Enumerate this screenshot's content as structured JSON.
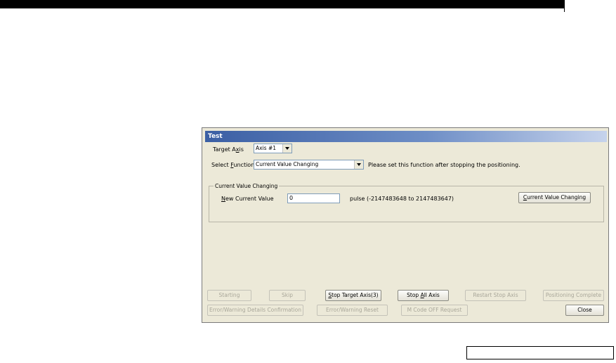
{
  "dialog": {
    "title": "Test",
    "target_axis": {
      "label_pre": "Target A",
      "label_key": "x",
      "label_post": "is",
      "value": "Axis #1"
    },
    "select_function": {
      "label_pre": "Select ",
      "label_key": "F",
      "label_post": "unction",
      "value": "Current Value Changing"
    },
    "note": "Please set this function after stopping the positioning.",
    "group": {
      "legend": "Current Value Changing",
      "field_label_key": "N",
      "field_label_post": "ew Current Value",
      "field_value": "0",
      "range_text": "pulse (-2147483648 to 2147483647)",
      "action_key": "C",
      "action_post": "urrent Value Changing"
    },
    "buttons_row1": {
      "starting": "Starting",
      "skip": "Skip",
      "stop_target_pre": "S",
      "stop_target_post": "top Target Axis(3)",
      "stop_all_pre": "Stop ",
      "stop_all_key": "A",
      "stop_all_post": "ll Axis",
      "restart": "Restart Stop Axis",
      "positioning_complete": "Positioning Complete"
    },
    "buttons_row2": {
      "error_details": "Error/Warning Details Confirmation",
      "error_reset": "Error/Warning Reset",
      "mcode_off": "M Code OFF Request",
      "close": "Close"
    }
  }
}
